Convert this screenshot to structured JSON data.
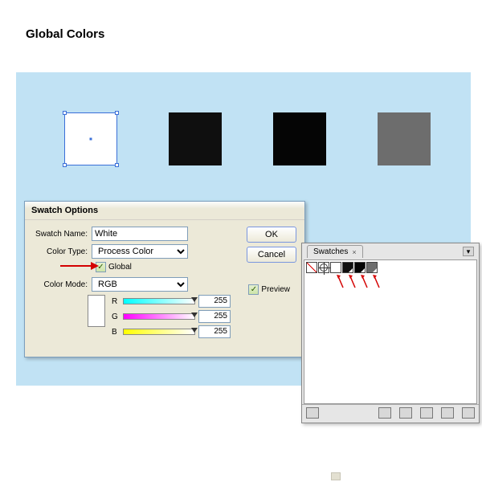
{
  "heading": "Global Colors",
  "squares": [
    {
      "fill": "#ffffff",
      "selected": true
    },
    {
      "fill": "#0f0f0f",
      "selected": false
    },
    {
      "fill": "#050505",
      "selected": false
    },
    {
      "fill": "#6d6d6d",
      "selected": false
    }
  ],
  "dialog": {
    "title": "Swatch Options",
    "fields": {
      "swatchNameLabel": "Swatch Name:",
      "swatchNameValue": "White",
      "colorTypeLabel": "Color Type:",
      "colorTypeValue": "Process Color",
      "globalLabel": "Global",
      "globalChecked": true,
      "colorModeLabel": "Color Mode:",
      "colorModeValue": "RGB",
      "channels": [
        {
          "label": "R",
          "value": "255",
          "gradient": "linear-gradient(to right,#00ffff,#ffffff)"
        },
        {
          "label": "G",
          "value": "255",
          "gradient": "linear-gradient(to right,#ff00ff,#ffffff)"
        },
        {
          "label": "B",
          "value": "255",
          "gradient": "linear-gradient(to right,#ffff00,#ffffff)"
        }
      ],
      "swatchPreviewColor": "#ffffff"
    },
    "buttons": {
      "ok": "OK",
      "cancel": "Cancel",
      "previewLabel": "Preview",
      "previewChecked": true
    }
  },
  "swatchesPanel": {
    "tabLabel": "Swatches",
    "swatches": [
      {
        "kind": "none"
      },
      {
        "kind": "registration"
      },
      {
        "kind": "color",
        "fill": "#ffffff",
        "global": true
      },
      {
        "kind": "color",
        "fill": "#0f0f0f",
        "global": true
      },
      {
        "kind": "color",
        "fill": "#050505",
        "global": true
      },
      {
        "kind": "color",
        "fill": "#6d6d6d",
        "global": true
      }
    ],
    "footerIcons": [
      "swatch-kinds-icon",
      "swatch-libraries-icon",
      "show-options-icon",
      "new-group-icon",
      "new-swatch-icon",
      "delete-swatch-icon"
    ]
  }
}
